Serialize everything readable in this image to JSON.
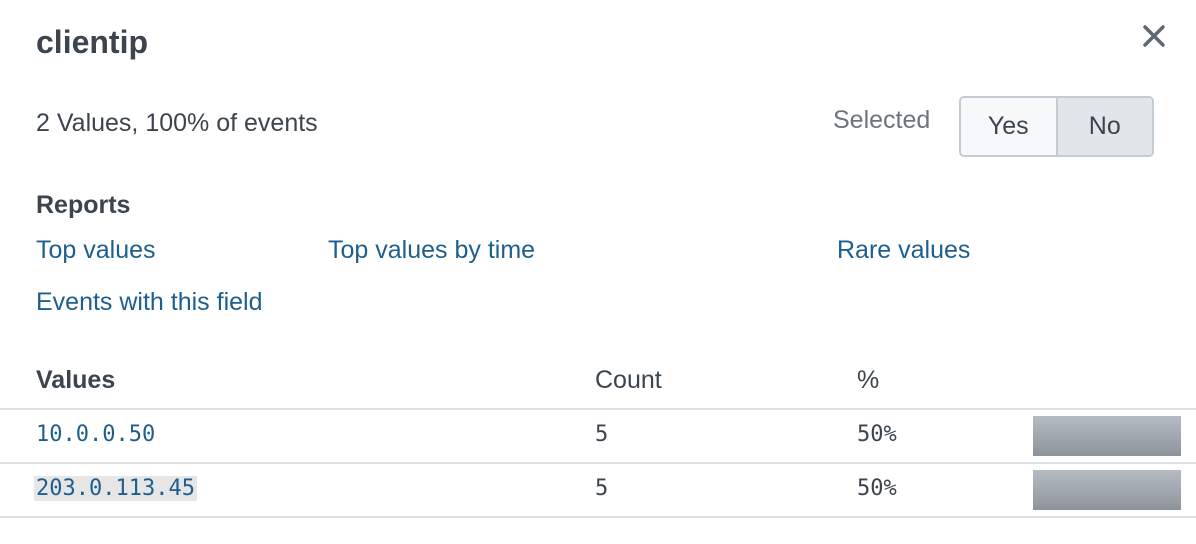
{
  "field": {
    "name": "clientip",
    "summary": "2 Values, 100% of events"
  },
  "selected": {
    "label": "Selected",
    "yes": "Yes",
    "no": "No",
    "value": "No"
  },
  "reports": {
    "heading": "Reports",
    "top_values": "Top values",
    "top_values_by_time": "Top values by time",
    "rare_values": "Rare values",
    "events_with_field": "Events with this field"
  },
  "table": {
    "headers": {
      "values": "Values",
      "count": "Count",
      "percent": "%"
    },
    "rows": [
      {
        "value": "10.0.0.50",
        "count": "5",
        "percent": "50%",
        "fraction": 0.5
      },
      {
        "value": "203.0.113.45",
        "count": "5",
        "percent": "50%",
        "fraction": 0.5
      }
    ]
  },
  "icons": {
    "close": "close-icon"
  },
  "colors": {
    "link": "#1e5f8e",
    "text": "#3c444d",
    "bar": "#9aa1aa"
  }
}
